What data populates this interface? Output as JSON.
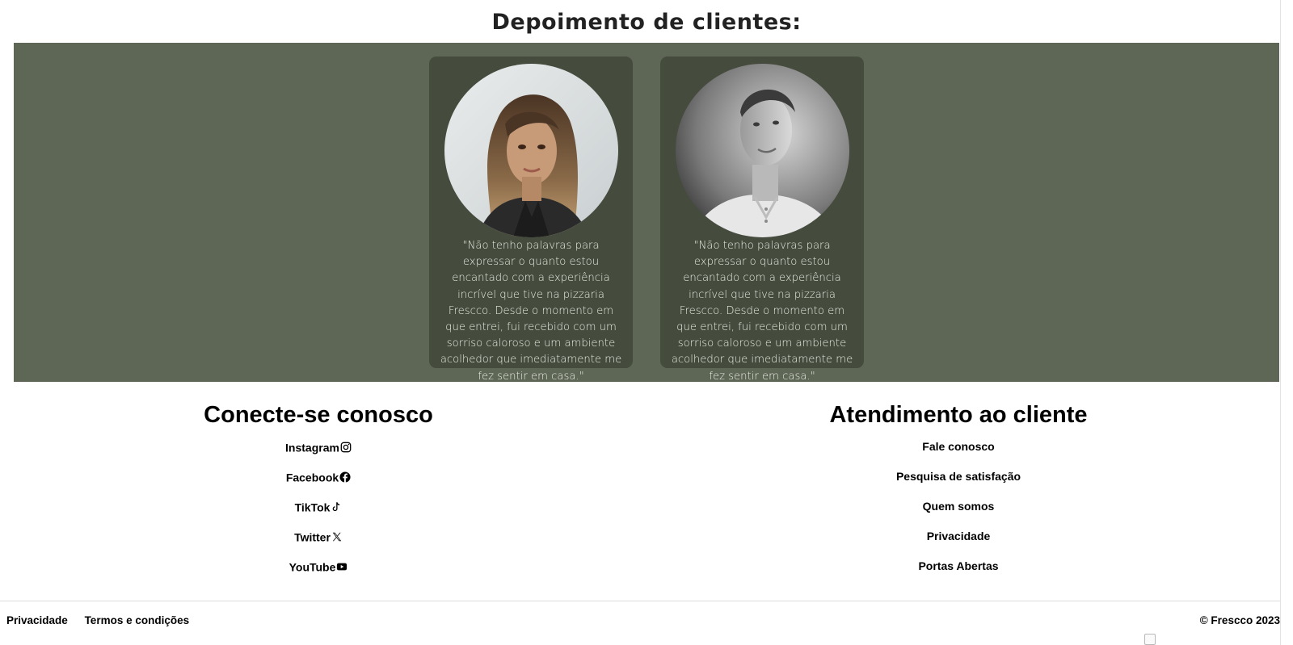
{
  "testimonials": {
    "title": "Depoimento de clientes:",
    "items": [
      {
        "photo": "woman-portrait-photo",
        "quote": "\"Não tenho palavras para expressar o quanto estou encantado com a experiência incrível que tive na pizzaria Frescco. Desde o momento em que entrei, fui recebido com um sorriso caloroso e um ambiente acolhedor que imediatamente me fez sentir em casa.\""
      },
      {
        "photo": "man-portrait-photo",
        "quote": "\"Não tenho palavras para expressar o quanto estou encantado com a experiência incrível que tive na pizzaria Frescco. Desde o momento em que entrei, fui recebido com um sorriso caloroso e um ambiente acolhedor que imediatamente me fez sentir em casa.\""
      }
    ]
  },
  "footer": {
    "connect": {
      "title": "Conecte-se conosco",
      "links": [
        {
          "label": "Instagram",
          "icon": "instagram-icon"
        },
        {
          "label": "Facebook",
          "icon": "facebook-icon"
        },
        {
          "label": "TikTok",
          "icon": "tiktok-icon"
        },
        {
          "label": "Twitter",
          "icon": "x-twitter-icon"
        },
        {
          "label": "YouTube",
          "icon": "youtube-icon"
        }
      ]
    },
    "support": {
      "title": "Atendimento ao cliente",
      "links": [
        {
          "label": "Fale conosco"
        },
        {
          "label": "Pesquisa de satisfação"
        },
        {
          "label": "Quem somos"
        },
        {
          "label": "Privacidade"
        },
        {
          "label": "Portas Abertas"
        }
      ]
    },
    "legal": {
      "privacy": "Privacidade",
      "terms": "Termos e condições"
    },
    "copyright": "© Frescco 2023"
  },
  "colors": {
    "band": "#5e6656",
    "card": "#454c3e",
    "quote_text": "#e8ebe2"
  }
}
